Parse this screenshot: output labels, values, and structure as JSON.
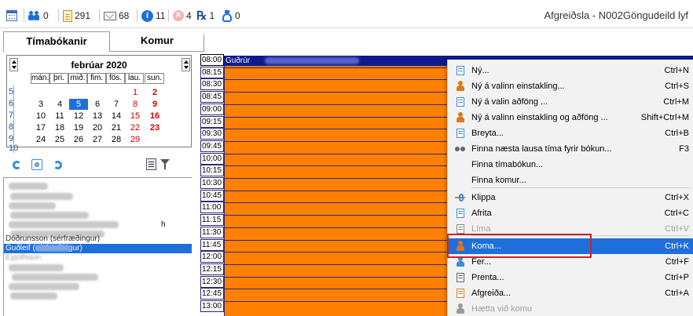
{
  "toolbar": {
    "items": [
      {
        "icon": "calendar-icon",
        "count": ""
      },
      {
        "icon": "people-icon",
        "count": "0"
      },
      {
        "icon": "document-icon",
        "count": "291"
      },
      {
        "icon": "envelope-icon",
        "count": "68"
      },
      {
        "icon": "info-icon",
        "count": "11"
      },
      {
        "icon": "cancel-circle-icon",
        "count": "4"
      },
      {
        "icon": "rx-icon",
        "count": "1"
      },
      {
        "icon": "bottle-icon",
        "count": "0"
      }
    ],
    "title": "Afgreiðsla - N002Göngudeild lyf"
  },
  "tabs": [
    "Tímabókanir",
    "Komur"
  ],
  "calendar": {
    "month": "febrúar 2020",
    "day_names": [
      "mán.",
      "þri.",
      "mið.",
      "fim.",
      "fös.",
      "lau.",
      "sun."
    ],
    "weeks": [
      "5",
      "6",
      "7",
      "8",
      "9",
      "10"
    ],
    "rows": [
      [
        "",
        "",
        "",
        "",
        "",
        "1",
        "2"
      ],
      [
        "3",
        "4",
        "5",
        "6",
        "7",
        "8",
        "9"
      ],
      [
        "10",
        "11",
        "12",
        "13",
        "14",
        "15",
        "16"
      ],
      [
        "17",
        "18",
        "19",
        "20",
        "21",
        "22",
        "23"
      ],
      [
        "24",
        "25",
        "26",
        "27",
        "28",
        "29",
        ""
      ]
    ],
    "selected": "5",
    "colors": {
      "weekend": "#d00000",
      "selected": "#1e6fd9"
    }
  },
  "list": {
    "rows": [
      {
        "text": "Dóðrunsson (sérfræðingur)",
        "selected": false
      },
      {
        "text": "Guðleif (sérfræðingur)",
        "selected": true
      },
      {
        "text": "Eyjólfsson",
        "selected": false
      }
    ],
    "partial_a": "h"
  },
  "schedule": {
    "times": [
      "08:00",
      "08:15",
      "08:30",
      "08:45",
      "09:00",
      "09:15",
      "09:30",
      "09:45",
      "10:00",
      "10:15",
      "10:30",
      "10:45",
      "11:00",
      "11:15",
      "11:30",
      "11:45",
      "12:00",
      "12:15",
      "12:30",
      "12:45",
      "13:00"
    ],
    "first_booking": "Guðrúr",
    "colors": {
      "booking": "#ff8000",
      "header": "#0d1b8f"
    }
  },
  "context_menu": [
    {
      "icon": "new-icon",
      "label": "Ný...",
      "shortcut": "Ctrl+N",
      "disabled": false
    },
    {
      "icon": "person-icon",
      "label": "Ný á valinn einstakling...",
      "shortcut": "Ctrl+S",
      "disabled": false
    },
    {
      "icon": "new-icon",
      "label": "Ný á valin aðföng ...",
      "shortcut": "Ctrl+M",
      "disabled": false
    },
    {
      "icon": "person-icon",
      "label": "Ný á valinn einstakling og aðföng ...",
      "shortcut": "Shift+Ctrl+M",
      "disabled": false
    },
    {
      "icon": "edit-icon",
      "label": "Breyta...",
      "shortcut": "Ctrl+B",
      "disabled": false
    },
    {
      "icon": "binoculars-icon",
      "label": "Finna næsta lausa tíma fyrir bókun...",
      "shortcut": "F3",
      "disabled": false
    },
    {
      "icon": "",
      "label": "Finna tímabókun...",
      "shortcut": "",
      "disabled": false
    },
    {
      "icon": "",
      "label": "Finna komur...",
      "shortcut": "",
      "disabled": false
    },
    {
      "icon": "cut-icon",
      "label": "Klippa",
      "shortcut": "Ctrl+X",
      "disabled": false
    },
    {
      "icon": "copy-icon",
      "label": "Afrita",
      "shortcut": "Ctrl+C",
      "disabled": false
    },
    {
      "icon": "paste-icon",
      "label": "Líma",
      "shortcut": "Ctrl+V",
      "disabled": true
    },
    {
      "icon": "person-arrive-icon",
      "label": "Koma...",
      "shortcut": "Ctrl+K",
      "disabled": false,
      "highlighted": true
    },
    {
      "icon": "person-leave-icon",
      "label": "Fer...",
      "shortcut": "Ctrl+F",
      "disabled": false
    },
    {
      "icon": "print-icon",
      "label": "Prenta...",
      "shortcut": "Ctrl+P",
      "disabled": false
    },
    {
      "icon": "bottle-icon",
      "label": "Afgreiða...",
      "shortcut": "Ctrl+A",
      "disabled": false
    },
    {
      "icon": "person-gray-icon",
      "label": "Hætta við komu",
      "shortcut": "",
      "disabled": true
    }
  ]
}
